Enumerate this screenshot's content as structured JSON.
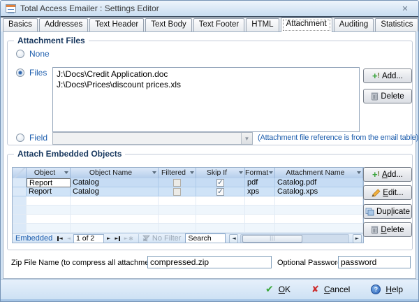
{
  "window": {
    "title": "Total Access Emailer : Settings Editor",
    "close_glyph": "✕"
  },
  "tabs": {
    "selected": "Attachment",
    "items": [
      {
        "label": "Basics"
      },
      {
        "label": "Addresses"
      },
      {
        "label": "Text Header"
      },
      {
        "label": "Text Body"
      },
      {
        "label": "Text Footer"
      },
      {
        "label": "HTML"
      },
      {
        "label": "Attachment"
      },
      {
        "label": "Auditing"
      },
      {
        "label": "Statistics"
      }
    ]
  },
  "attachment_files": {
    "group_label": "Attachment Files",
    "radio_none_label": "None",
    "radio_files_label": "Files",
    "radio_field_label": "Field",
    "selected_radio": "Files",
    "files": [
      "J:\\Docs\\Credit Application.doc",
      "J:\\Docs\\Prices\\discount prices.xls"
    ],
    "add_label": "Add...",
    "delete_label": "Delete",
    "field_note": "(Attachment file reference is from the email table)"
  },
  "embedded": {
    "group_label": "Attach Embedded Objects",
    "columns": [
      "Object Type",
      "Object Name",
      "Filtered",
      "Skip If Empty",
      "Format",
      "Attachment Name"
    ],
    "rows": [
      {
        "object_type": "Report",
        "object_name": "Catalog",
        "filtered": false,
        "skip_if_empty": true,
        "format": "pdf",
        "attachment_name": "Catalog.pdf"
      },
      {
        "object_type": "Report",
        "object_name": "Catalog",
        "filtered": false,
        "skip_if_empty": true,
        "format": "xps",
        "attachment_name": "Catalog.xps"
      }
    ],
    "empty_row_count": 4,
    "nav": {
      "label": "Embedded",
      "position": "1 of 2",
      "no_filter_label": "No Filter",
      "search_value": "Search",
      "thumb_grip": "|||"
    },
    "buttons": {
      "add": {
        "pre": "",
        "key": "A",
        "post": "dd..."
      },
      "edit": {
        "pre": "",
        "key": "E",
        "post": "dit..."
      },
      "duplicate": {
        "pre": "Dup",
        "key": "l",
        "post": "icate"
      },
      "delete": {
        "pre": "",
        "key": "D",
        "post": "elete"
      }
    }
  },
  "zip": {
    "label": "Zip File Name (to compress all attachments):",
    "value": "compressed.zip"
  },
  "password": {
    "label": "Optional Password:",
    "value": "password"
  },
  "footer": {
    "ok": {
      "pre": "",
      "key": "O",
      "post": "K"
    },
    "cancel": {
      "pre": "",
      "key": "C",
      "post": "ancel"
    },
    "help": {
      "pre": "",
      "key": "H",
      "post": "elp"
    }
  },
  "colors": {
    "label_blue": "#1f5fae",
    "group_label_navy": "#17375e",
    "row_highlight": "#c6dcf4",
    "ok_green": "#3aa83a",
    "cancel_red": "#cc2b2b",
    "help_blue": "#2a62b8"
  }
}
